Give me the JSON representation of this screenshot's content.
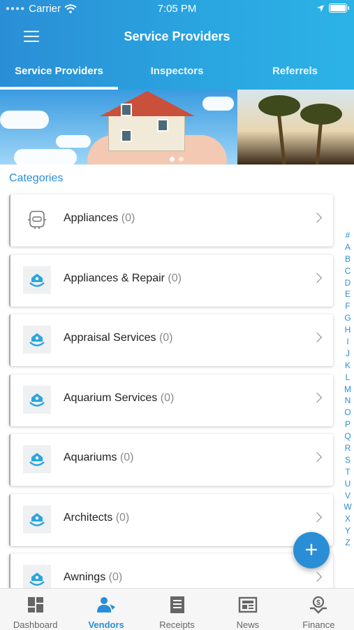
{
  "status": {
    "carrier": "Carrier",
    "time": "7:05 PM"
  },
  "header": {
    "title": "Service Providers"
  },
  "tabs": [
    {
      "label": "Service Providers",
      "active": true
    },
    {
      "label": "Inspectors",
      "active": false
    },
    {
      "label": "Referrels",
      "active": false
    }
  ],
  "banner": {
    "pages": 2,
    "current": 1
  },
  "categories_title": "Categories",
  "categories": [
    {
      "name": "Appliances",
      "count": "(0)",
      "icon": "appliance-robot-icon"
    },
    {
      "name": "Appliances & Repair",
      "count": "(0)",
      "icon": "home-hand-icon"
    },
    {
      "name": "Appraisal Services",
      "count": "(0)",
      "icon": "home-hand-icon"
    },
    {
      "name": "Aquarium Services",
      "count": "(0)",
      "icon": "home-hand-icon"
    },
    {
      "name": "Aquariums",
      "count": "(0)",
      "icon": "home-hand-icon"
    },
    {
      "name": "Architects",
      "count": "(0)",
      "icon": "home-hand-icon"
    },
    {
      "name": "Awnings",
      "count": "(0)",
      "icon": "home-hand-icon"
    }
  ],
  "alphabet": [
    "#",
    "A",
    "B",
    "C",
    "D",
    "E",
    "F",
    "G",
    "H",
    "I",
    "J",
    "K",
    "L",
    "M",
    "N",
    "O",
    "P",
    "Q",
    "R",
    "S",
    "T",
    "U",
    "V",
    "W",
    "X",
    "Y",
    "Z"
  ],
  "fab_label": "+",
  "bottom_nav": [
    {
      "label": "Dashboard",
      "icon": "dashboard-icon",
      "active": false
    },
    {
      "label": "Vendors",
      "icon": "vendors-icon",
      "active": true
    },
    {
      "label": "Receipts",
      "icon": "receipts-icon",
      "active": false
    },
    {
      "label": "News",
      "icon": "news-icon",
      "active": false
    },
    {
      "label": "Finance",
      "icon": "finance-icon",
      "active": false
    }
  ],
  "colors": {
    "primary": "#2a8ed6",
    "header_gradient_end": "#2cb3e6",
    "inactive": "#666666"
  }
}
